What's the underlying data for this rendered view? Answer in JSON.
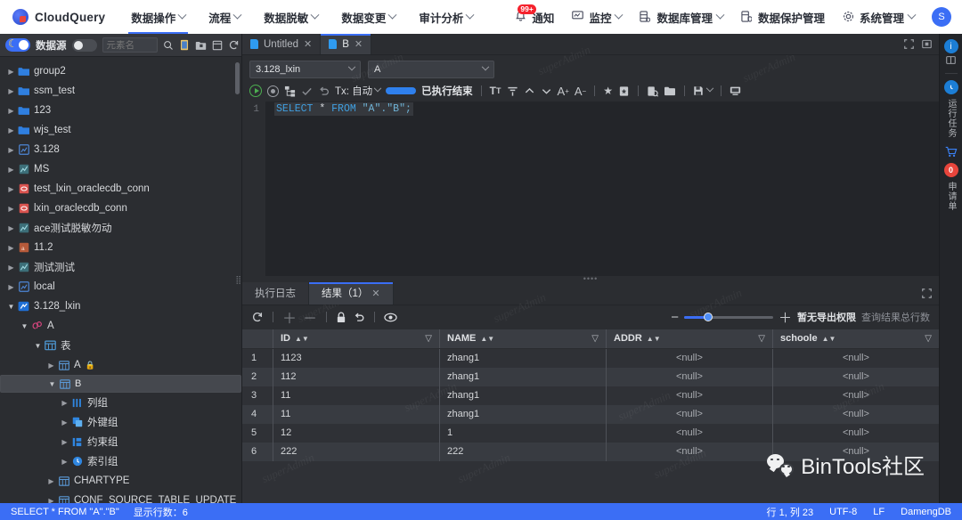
{
  "header": {
    "brand": "CloudQuery",
    "nav": [
      {
        "label": "数据操作",
        "caret": true,
        "active": true
      },
      {
        "label": "流程",
        "caret": true,
        "active": false
      },
      {
        "label": "数据脱敏",
        "caret": true,
        "active": false
      },
      {
        "label": "数据变更",
        "caret": true,
        "active": false
      },
      {
        "label": "审计分析",
        "caret": true,
        "active": false
      }
    ],
    "right": [
      {
        "label": "通知",
        "icon": "bell-icon",
        "badge": "99+",
        "caret": false
      },
      {
        "label": "监控",
        "icon": "monitor-icon",
        "badge": "",
        "caret": true
      },
      {
        "label": "数据库管理",
        "icon": "database-icon",
        "badge": "",
        "caret": true
      },
      {
        "label": "数据保护管理",
        "icon": "shield-db-icon",
        "badge": "",
        "caret": false
      },
      {
        "label": "系统管理",
        "icon": "gear-icon",
        "badge": "",
        "caret": true
      }
    ],
    "avatar": "S"
  },
  "sidebar": {
    "toolbar": {
      "theme_label": "数据源",
      "search_placeholder": "元素名",
      "icons": [
        "search-icon",
        "sql-file-icon",
        "folder-add-icon",
        "panel-icon",
        "refresh-icon"
      ]
    },
    "tree": [
      {
        "label": "group2",
        "icon": "folder-icon",
        "depth": 0,
        "open": false,
        "selected": false
      },
      {
        "label": "ssm_test",
        "icon": "folder-icon",
        "depth": 0,
        "open": false,
        "selected": false
      },
      {
        "label": "123",
        "icon": "folder-icon",
        "depth": 0,
        "open": false,
        "selected": false
      },
      {
        "label": "wjs_test",
        "icon": "folder-icon",
        "depth": 0,
        "open": false,
        "selected": false
      },
      {
        "label": "3.128",
        "icon": "db-blue-icon",
        "depth": 0,
        "open": false,
        "selected": false
      },
      {
        "label": "MS",
        "icon": "db-teal-icon",
        "depth": 0,
        "open": false,
        "selected": false
      },
      {
        "label": "test_lxin_oraclecdb_conn",
        "icon": "db-red-icon",
        "depth": 0,
        "open": false,
        "selected": false
      },
      {
        "label": "lxin_oraclecdb_conn",
        "icon": "db-red-icon",
        "depth": 0,
        "open": false,
        "selected": false
      },
      {
        "label": "ace测试脱敏勿动",
        "icon": "db-teal-icon",
        "depth": 0,
        "open": false,
        "selected": false
      },
      {
        "label": "11.2",
        "icon": "db-orange-icon",
        "depth": 0,
        "open": false,
        "selected": false
      },
      {
        "label": "测试测试",
        "icon": "db-teal-icon",
        "depth": 0,
        "open": false,
        "selected": false
      },
      {
        "label": "local",
        "icon": "db-blue-icon",
        "depth": 0,
        "open": false,
        "selected": false
      },
      {
        "label": "3.128_lxin",
        "icon": "db-active-icon",
        "depth": 0,
        "open": true,
        "selected": false
      },
      {
        "label": "A",
        "icon": "schema-icon",
        "depth": 1,
        "open": true,
        "selected": false
      },
      {
        "label": "表",
        "icon": "table-group-icon",
        "depth": 2,
        "open": true,
        "selected": false
      },
      {
        "label": "A",
        "icon": "table-icon",
        "depth": 3,
        "open": false,
        "selected": false,
        "locked": true
      },
      {
        "label": "B",
        "icon": "table-icon",
        "depth": 3,
        "open": true,
        "selected": true
      },
      {
        "label": "列组",
        "icon": "columns-icon",
        "depth": 4,
        "open": false,
        "selected": false
      },
      {
        "label": "外键组",
        "icon": "foreign-key-icon",
        "depth": 4,
        "open": false,
        "selected": false
      },
      {
        "label": "约束组",
        "icon": "constraint-icon",
        "depth": 4,
        "open": false,
        "selected": false
      },
      {
        "label": "索引组",
        "icon": "index-icon",
        "depth": 4,
        "open": false,
        "selected": false
      },
      {
        "label": "CHARTYPE",
        "icon": "table-icon",
        "depth": 3,
        "open": false,
        "selected": false
      },
      {
        "label": "CONF_SOURCE_TABLE_UPDATE",
        "icon": "table-icon",
        "depth": 3,
        "open": false,
        "selected": false
      }
    ]
  },
  "editor": {
    "tabs": [
      {
        "label": "Untitled",
        "active": false
      },
      {
        "label": "B",
        "active": true
      }
    ],
    "connection": "3.128_lxin",
    "schema": "A",
    "tx_label": "Tx: 自动",
    "exec_status": "已执行结束",
    "code_line_number": "1",
    "code": {
      "keyword1": "SELECT",
      "star": "*",
      "keyword2": "FROM",
      "target": "\"A\".\"B\";"
    }
  },
  "result": {
    "tabs": [
      {
        "label": "执行日志",
        "active": false,
        "closable": false
      },
      {
        "label": "结果（1）",
        "active": true,
        "closable": true
      }
    ],
    "toolbar_icons": [
      "refresh-icon",
      "add-row-icon",
      "remove-row-icon",
      "lock-icon",
      "undo-icon",
      "eye-icon"
    ],
    "no_export_permission": "暂无导出权限",
    "total_rows_label": "查询结果总行数",
    "columns": [
      "ID",
      "NAME",
      "ADDR",
      "schoole"
    ],
    "rows": [
      {
        "idx": "1",
        "ID": "1123",
        "NAME": "zhang1",
        "ADDR": "<null>",
        "schoole": "<null>"
      },
      {
        "idx": "2",
        "ID": "112",
        "NAME": "zhang1",
        "ADDR": "<null>",
        "schoole": "<null>"
      },
      {
        "idx": "3",
        "ID": "11",
        "NAME": "zhang1",
        "ADDR": "<null>",
        "schoole": "<null>"
      },
      {
        "idx": "4",
        "ID": "11",
        "NAME": "zhang1",
        "ADDR": "<null>",
        "schoole": "<null>"
      },
      {
        "idx": "5",
        "ID": "12",
        "NAME": "1",
        "ADDR": "<null>",
        "schoole": "<null>"
      },
      {
        "idx": "6",
        "ID": "222",
        "NAME": "222",
        "ADDR": "<null>",
        "schoole": "<null>"
      }
    ]
  },
  "rail": {
    "info_icon": "info-icon",
    "widget_icon": "widget-icon",
    "clock_icon": "clock-icon",
    "running_tasks": "运行任务",
    "cart_icon": "cart-icon",
    "cart_badge": "0",
    "request_form": "申请单"
  },
  "watermark": {
    "text": "superAdmin",
    "brand": "BinTools社区"
  },
  "status_bar": {
    "query": "SELECT * FROM \"A\".\"B\"",
    "rows_shown": "显示行数：6",
    "position": "行 1, 列 23",
    "encoding": "UTF-8",
    "line_ending": "LF",
    "db_type": "DamengDB"
  }
}
